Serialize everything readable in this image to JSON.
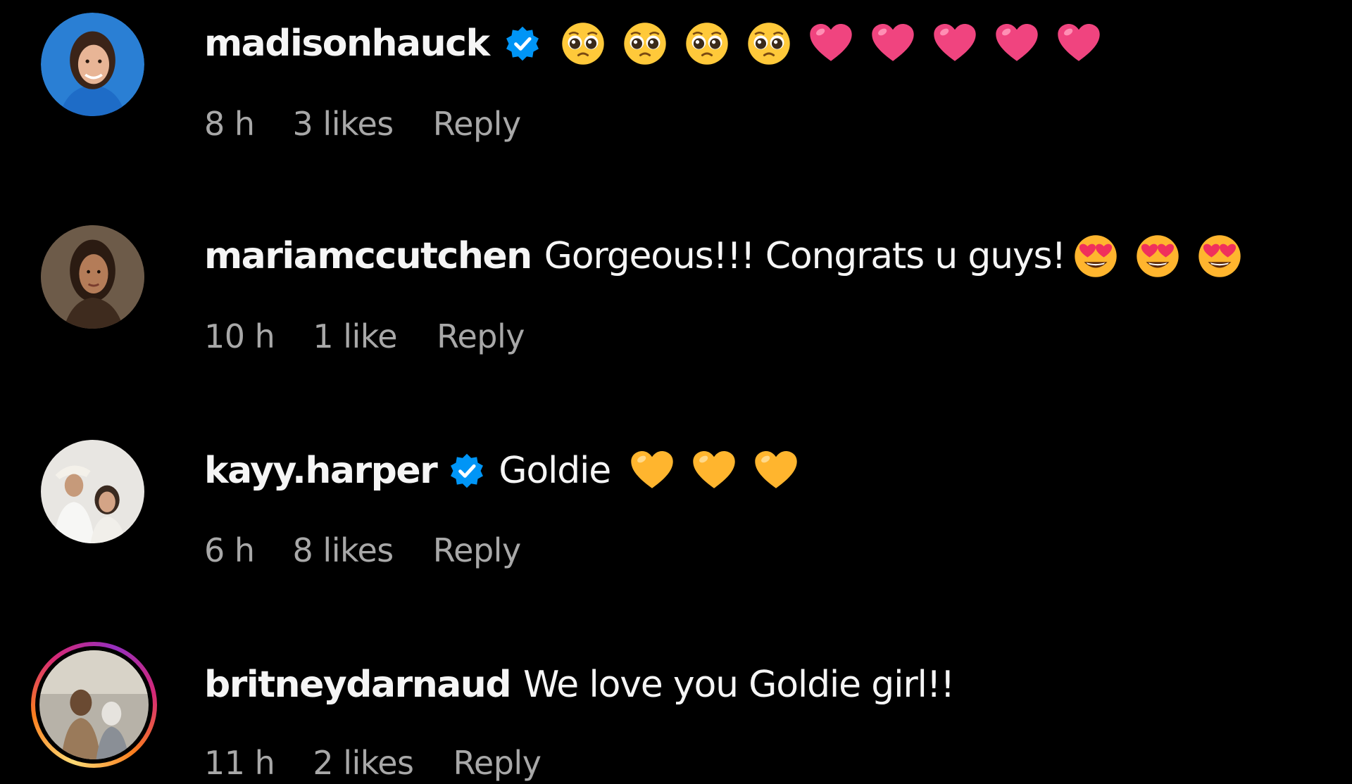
{
  "comments": [
    {
      "username": "madisonhauck",
      "verified": true,
      "text": "",
      "emojis": [
        "pleading-face",
        "pleading-face",
        "pleading-face",
        "pleading-face",
        "pink-heart",
        "pink-heart",
        "pink-heart",
        "pink-heart",
        "pink-heart"
      ],
      "time": "8 h",
      "likes": "3 likes",
      "reply": "Reply",
      "avatar": "avatar-photo"
    },
    {
      "username": "mariamccutchen",
      "verified": false,
      "text": "Gorgeous!!! Congrats u guys!",
      "emojis": [
        "heart-eyes-face",
        "heart-eyes-face",
        "heart-eyes-face"
      ],
      "time": "10 h",
      "likes": "1 like",
      "reply": "Reply",
      "avatar": "avatar-photo"
    },
    {
      "username": "kayy.harper",
      "verified": true,
      "text": "Goldie",
      "emojis": [
        "yellow-heart",
        "yellow-heart",
        "yellow-heart"
      ],
      "time": "6 h",
      "likes": "8 likes",
      "reply": "Reply",
      "avatar": "avatar-photo"
    },
    {
      "username": "britneydarnaud",
      "verified": false,
      "text": "We love you Goldie girl!!",
      "emojis": [],
      "time": "11 h",
      "likes": "2 likes",
      "reply": "Reply",
      "avatar": "avatar-photo-with-story-ring"
    }
  ],
  "colors": {
    "background": "#000000",
    "text_primary": "#f5f5f5",
    "text_secondary": "#a8a8a8",
    "verified_badge": "#0095f6",
    "pink_heart": "#f0447f",
    "yellow_heart": "#ffb52e"
  }
}
